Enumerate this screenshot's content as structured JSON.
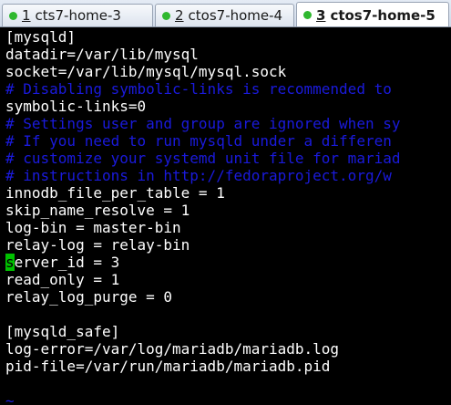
{
  "tabs": [
    {
      "number": "1",
      "title": "cts7-home-3",
      "dot_color": "#2fb82f",
      "active": false
    },
    {
      "number": "2",
      "title": "ctos7-home-4",
      "dot_color": "#2fb82f",
      "active": false
    },
    {
      "number": "3",
      "title": "ctos7-home-5",
      "dot_color": "#2fb82f",
      "active": true
    }
  ],
  "terminal": {
    "lines": [
      {
        "text": "[mysqld]",
        "kind": "normal"
      },
      {
        "text": "datadir=/var/lib/mysql",
        "kind": "normal"
      },
      {
        "text": "socket=/var/lib/mysql/mysql.sock",
        "kind": "normal"
      },
      {
        "text": "# Disabling symbolic-links is recommended to",
        "kind": "comment"
      },
      {
        "text": "symbolic-links=0",
        "kind": "normal"
      },
      {
        "text": "# Settings user and group are ignored when sy",
        "kind": "comment"
      },
      {
        "text": "# If you need to run mysqld under a differen",
        "kind": "comment"
      },
      {
        "text": "# customize your systemd unit file for mariad",
        "kind": "comment"
      },
      {
        "text": "# instructions in http://fedoraproject.org/w",
        "kind": "comment"
      },
      {
        "text": "innodb_file_per_table = 1",
        "kind": "normal"
      },
      {
        "text": "skip_name_resolve = 1",
        "kind": "normal"
      },
      {
        "text": "log-bin = master-bin",
        "kind": "normal"
      },
      {
        "text": "relay-log = relay-bin",
        "kind": "normal"
      },
      {
        "text": "server_id = 3",
        "kind": "cursor"
      },
      {
        "text": "read_only = 1",
        "kind": "normal"
      },
      {
        "text": "relay_log_purge = 0",
        "kind": "normal"
      },
      {
        "text": "",
        "kind": "normal"
      },
      {
        "text": "[mysqld_safe]",
        "kind": "normal"
      },
      {
        "text": "log-error=/var/log/mariadb/mariadb.log",
        "kind": "normal"
      },
      {
        "text": "pid-file=/var/run/mariadb/mariadb.pid",
        "kind": "normal"
      },
      {
        "text": "",
        "kind": "normal"
      },
      {
        "text": "~",
        "kind": "tilde"
      }
    ],
    "colors": {
      "background": "#000000",
      "foreground": "#ffffff",
      "comment": "#1a1adc",
      "cursor": "#00c000"
    }
  }
}
